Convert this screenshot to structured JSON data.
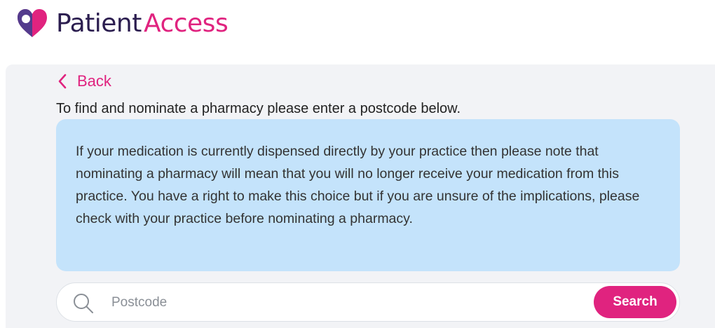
{
  "brand": {
    "name_part1": "Patient",
    "name_part2": "Access",
    "primary_color": "#e0237f",
    "dark_color": "#2b1d4f",
    "accent_color": "#e0237f",
    "icon": "heart-pin-icon"
  },
  "nav": {
    "back_label": "Back",
    "back_icon": "chevron-left-icon"
  },
  "content": {
    "intro": "To find and nominate a pharmacy please enter a postcode below.",
    "notice": "If your medication is currently dispensed directly by your practice then please note that nominating a pharmacy will mean that you will no longer receive your medication from this practice. You have a right to make this choice but if you are unsure of the implications, please check with your practice before nominating a pharmacy.",
    "notice_bg": "#c4e3fb"
  },
  "search": {
    "icon": "search-icon",
    "placeholder": "Postcode",
    "value": "",
    "button_label": "Search"
  }
}
